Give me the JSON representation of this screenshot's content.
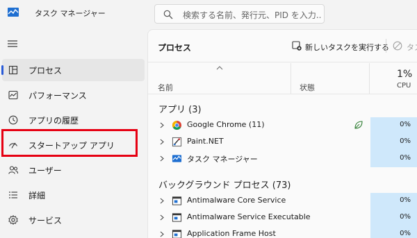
{
  "titlebar": {
    "title": "タスク マネージャー",
    "search_placeholder": "検索する名前、発行元、PID を入力..."
  },
  "sidebar": {
    "items": [
      {
        "label": "プロセス",
        "icon": "processes-icon",
        "active": true
      },
      {
        "label": "パフォーマンス",
        "icon": "performance-icon"
      },
      {
        "label": "アプリの履歴",
        "icon": "history-icon"
      },
      {
        "label": "スタートアップ アプリ",
        "icon": "startup-icon",
        "highlighted": true
      },
      {
        "label": "ユーザー",
        "icon": "users-icon"
      },
      {
        "label": "詳細",
        "icon": "details-icon"
      },
      {
        "label": "サービス",
        "icon": "services-icon"
      }
    ]
  },
  "main": {
    "title": "プロセス",
    "run_task_label": "新しいタスクを実行する",
    "end_task_label": "タス",
    "columns": {
      "name": "名前",
      "status": "状態",
      "cpu_percent": "1%",
      "cpu": "CPU"
    },
    "groups": {
      "apps": {
        "label": "アプリ (3)",
        "rows": [
          {
            "name": "Google Chrome (11)",
            "cpu": "0%",
            "icon": "chrome-icon",
            "status_icon": "efficiency-leaf-icon"
          },
          {
            "name": "Paint.NET",
            "cpu": "0%",
            "icon": "paintnet-icon"
          },
          {
            "name": "タスク マネージャー",
            "cpu": "0%",
            "icon": "task-manager-icon"
          }
        ]
      },
      "background": {
        "label": "バックグラウンド プロセス (73)",
        "rows": [
          {
            "name": "Antimalware Core Service",
            "cpu": "0%",
            "icon": "service-window-icon"
          },
          {
            "name": "Antimalware Service Executable",
            "cpu": "0%",
            "icon": "service-window-icon"
          },
          {
            "name": "Application Frame Host",
            "cpu": "0%",
            "icon": "service-window-icon"
          }
        ]
      }
    }
  },
  "colors": {
    "accent": "#2a5bd7",
    "highlight_red": "#e60012",
    "cpu_cell": "#cfe8fb"
  }
}
